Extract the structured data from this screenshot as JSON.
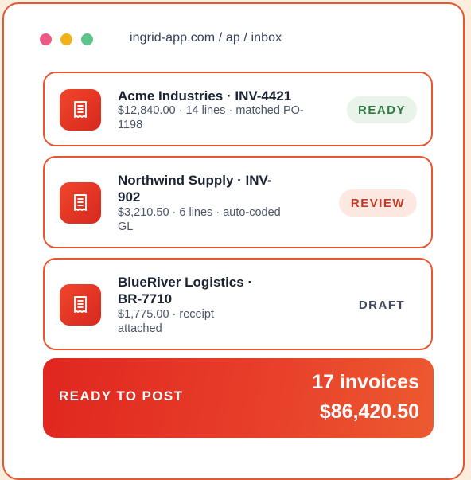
{
  "window": {
    "url": "ingrid-app.com / ap / inbox",
    "dots": {
      "red": "#EE5A86",
      "yellow": "#F2B21B",
      "green": "#5CC48A"
    }
  },
  "invoices": [
    {
      "title": "Acme Industries · INV-4421",
      "subtitle": "$12,840.00 · 14 lines · matched PO-1198",
      "status": "READY",
      "icon": "receipt-icon"
    },
    {
      "title": "Northwind Supply · INV-902",
      "subtitle": "$3,210.50 · 6 lines · auto-coded GL",
      "status": "REVIEW",
      "icon": "receipt-icon"
    },
    {
      "title": "BlueRiver Logistics · BR-7710",
      "subtitle": "$1,775.00 · receipt attached",
      "status": "DRAFT",
      "icon": "receipt-icon"
    }
  ],
  "post": {
    "label": "READY TO POST",
    "count": "17 invoices",
    "total": "$86,420.50"
  },
  "colors": {
    "accent": "#E8552F",
    "background": "#FCEDDD",
    "ready": "#2F7A43",
    "review": "#C43A26"
  }
}
